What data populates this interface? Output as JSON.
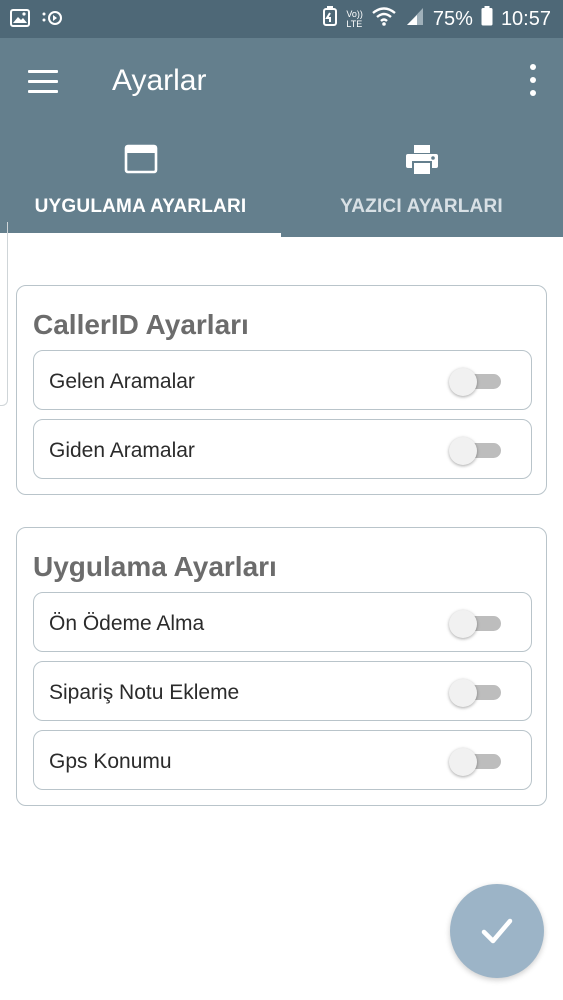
{
  "status_bar": {
    "battery": "75%",
    "time": "10:57",
    "network_label_top": "Vo))",
    "network_label_bottom": "LTE"
  },
  "app_bar": {
    "title": "Ayarlar"
  },
  "tabs": [
    {
      "label": "UYGULAMA AYARLARI",
      "icon": "window-icon",
      "active": true
    },
    {
      "label": "YAZICI AYARLARI",
      "icon": "printer-icon",
      "active": false
    }
  ],
  "sections": [
    {
      "title": "CallerID Ayarları",
      "items": [
        {
          "label": "Gelen Aramalar",
          "enabled": false
        },
        {
          "label": "Giden Aramalar",
          "enabled": false
        }
      ]
    },
    {
      "title": "Uygulama Ayarları",
      "items": [
        {
          "label": "Ön Ödeme Alma",
          "enabled": false
        },
        {
          "label": "Sipariş Notu Ekleme",
          "enabled": false
        },
        {
          "label": "Gps Konumu",
          "enabled": false
        }
      ]
    }
  ],
  "colors": {
    "status_bar": "#4e6877",
    "app_bar": "#647f8d",
    "fab": "#9cb4c7",
    "border": "#b9c4ca"
  }
}
